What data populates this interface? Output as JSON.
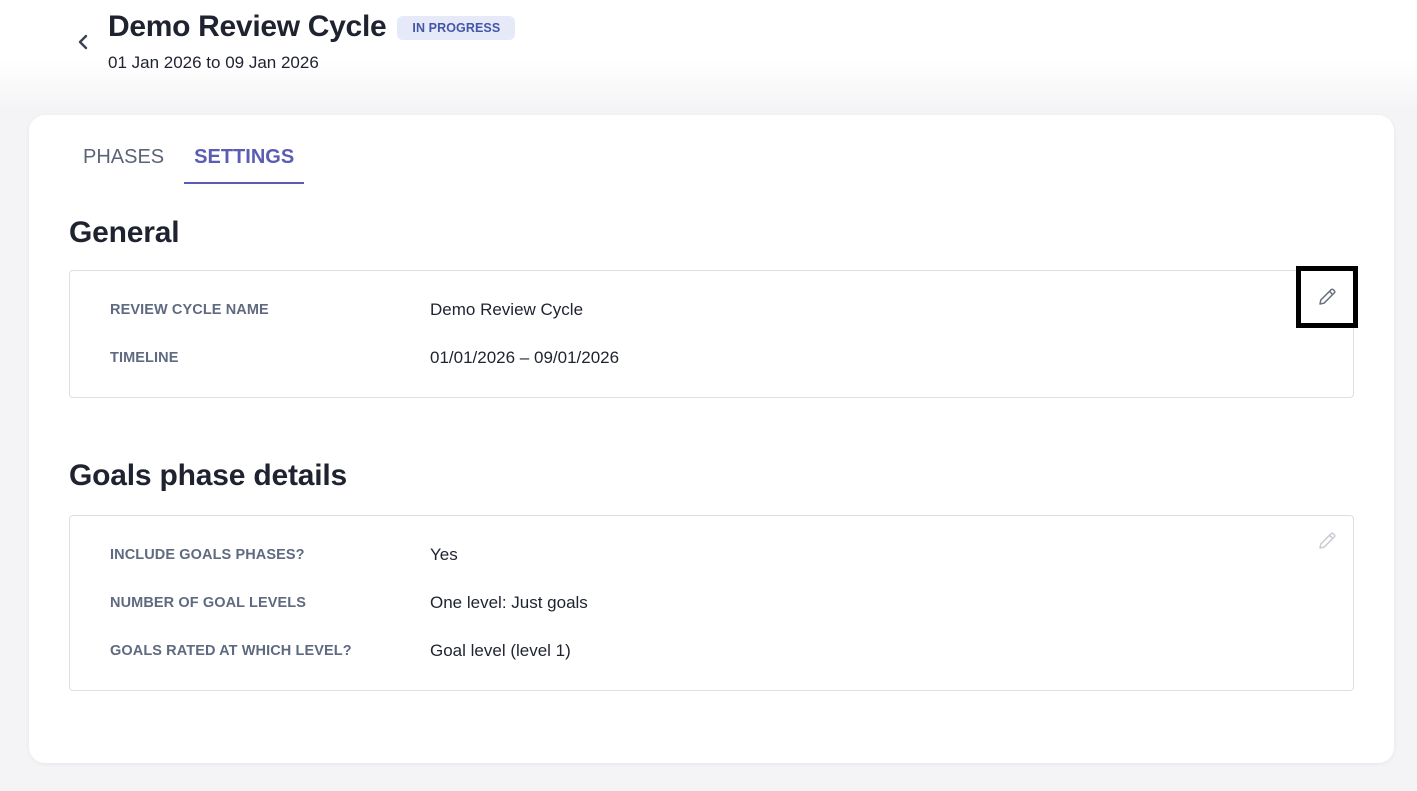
{
  "header": {
    "title": "Demo Review Cycle",
    "status": "IN PROGRESS",
    "date_range": "01 Jan 2026 to 09 Jan 2026",
    "back_icon": "chevron-left-icon"
  },
  "tabs": [
    {
      "label": "PHASES",
      "active": false
    },
    {
      "label": "SETTINGS",
      "active": true
    }
  ],
  "sections": {
    "general": {
      "title": "General",
      "edit_icon": "pencil-icon",
      "rows": [
        {
          "label": "REVIEW CYCLE NAME",
          "value": "Demo Review Cycle"
        },
        {
          "label": "TIMELINE",
          "value": "01/01/2026 – 09/01/2026"
        }
      ]
    },
    "goals": {
      "title": "Goals phase details",
      "edit_icon": "pencil-icon",
      "rows": [
        {
          "label": "INCLUDE GOALS PHASES?",
          "value": "Yes"
        },
        {
          "label": "NUMBER OF GOAL LEVELS",
          "value": "One level: Just goals"
        },
        {
          "label": "GOALS RATED AT WHICH LEVEL?",
          "value": "Goal level (level 1)"
        }
      ]
    }
  },
  "colors": {
    "accent": "#5b5db3",
    "badge_bg": "#e6e9f7",
    "badge_text": "#4456a8",
    "label_text": "#5f6a80"
  }
}
